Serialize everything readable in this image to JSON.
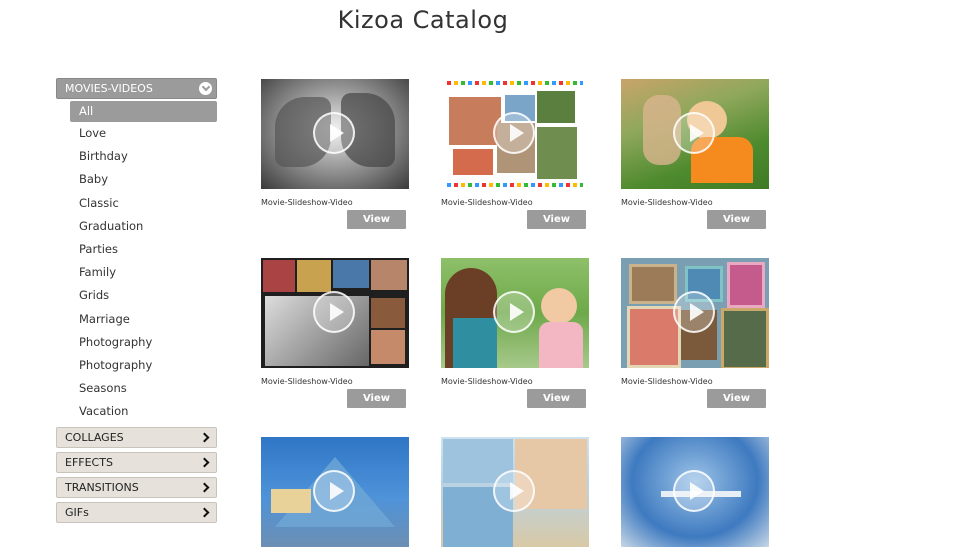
{
  "page": {
    "title": "Kizoa Catalog"
  },
  "sidebar": {
    "open_category": "MOVIES-VIDEOS",
    "sub_items": [
      {
        "label": "All",
        "active": true
      },
      {
        "label": "Love"
      },
      {
        "label": "Birthday"
      },
      {
        "label": "Baby"
      },
      {
        "label": "Classic"
      },
      {
        "label": "Graduation"
      },
      {
        "label": "Parties"
      },
      {
        "label": "Family"
      },
      {
        "label": "Grids"
      },
      {
        "label": "Marriage"
      },
      {
        "label": "Photography"
      },
      {
        "label": "Photography"
      },
      {
        "label": "Seasons"
      },
      {
        "label": "Vacation"
      }
    ],
    "collapsed_categories": [
      "COLLAGES",
      "EFFECTS",
      "TRANSITIONS",
      "GIFs"
    ]
  },
  "grid": {
    "items": [
      {
        "label": "Movie-Slideshow-Video",
        "button": "View"
      },
      {
        "label": "Movie-Slideshow-Video",
        "button": "View"
      },
      {
        "label": "Movie-Slideshow-Video",
        "button": "View"
      },
      {
        "label": "Movie-Slideshow-Video",
        "button": "View"
      },
      {
        "label": "Movie-Slideshow-Video",
        "button": "View"
      },
      {
        "label": "Movie-Slideshow-Video",
        "button": "View"
      },
      {
        "label": "",
        "button": ""
      },
      {
        "label": "",
        "button": ""
      },
      {
        "label": "",
        "button": ""
      }
    ]
  }
}
